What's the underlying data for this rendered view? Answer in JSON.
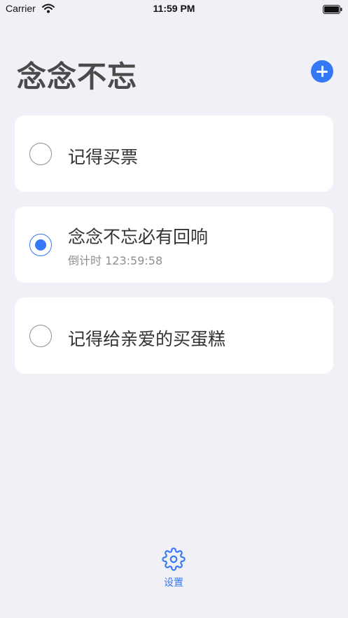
{
  "status_bar": {
    "carrier": "Carrier",
    "time": "11:59 PM",
    "icons": [
      "wifi-icon",
      "battery-icon"
    ]
  },
  "header": {
    "title": "念念不忘",
    "add_icon": "plus-circle-icon"
  },
  "reminders": [
    {
      "title": "记得买票",
      "selected": false,
      "subtitle": ""
    },
    {
      "title": "念念不忘必有回响",
      "selected": true,
      "subtitle": "倒计时 123:59:58"
    },
    {
      "title": "记得给亲爱的买蛋糕",
      "selected": false,
      "subtitle": ""
    }
  ],
  "tab_bar": {
    "settings_label": "设置",
    "settings_icon": "gear-icon"
  },
  "colors": {
    "background": "#f1f0f6",
    "accent": "#3478f6",
    "card": "#ffffff",
    "secondary_text": "#8e8e93"
  }
}
